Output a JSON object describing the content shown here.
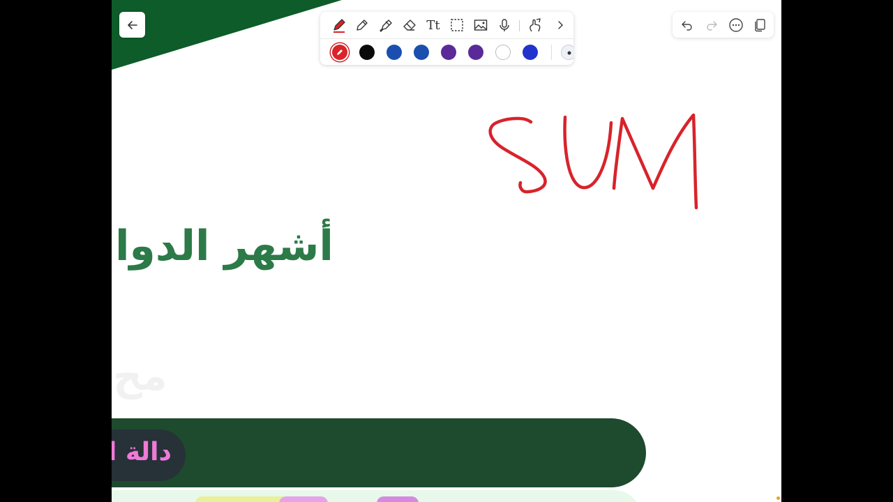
{
  "colors": {
    "brand_green": "#0d5c2a",
    "heading_green": "#2c7a48",
    "banner_green": "#1e4a2d",
    "pill_bg": "#263238",
    "pill_text": "#f07ad8",
    "ink_red": "#d8232a"
  },
  "toolbar": {
    "tools": [
      {
        "name": "pen",
        "icon": "pen-icon",
        "active": true
      },
      {
        "name": "pencil",
        "icon": "pencil-icon"
      },
      {
        "name": "highlighter",
        "icon": "highlighter-icon"
      },
      {
        "name": "eraser",
        "icon": "eraser-icon"
      },
      {
        "name": "text",
        "icon": "text-tool-icon",
        "label": "Tt"
      },
      {
        "name": "lasso-select",
        "icon": "select-icon"
      },
      {
        "name": "image",
        "icon": "image-icon"
      },
      {
        "name": "audio",
        "icon": "microphone-icon"
      },
      {
        "name": "touch-writing",
        "icon": "hand-pen-icon"
      },
      {
        "name": "more",
        "icon": "chevron-right-icon"
      }
    ],
    "swatches": [
      {
        "color": "#d8232a",
        "selected": true
      },
      {
        "color": "#0a0a0a"
      },
      {
        "color": "#1a4fb0"
      },
      {
        "color": "#1a4fb0"
      },
      {
        "color": "#5b2a99"
      },
      {
        "color": "#5b2a99"
      },
      {
        "color": "#ffffff"
      },
      {
        "color": "#2233cc"
      }
    ]
  },
  "header_actions": {
    "back": "arrow-left-icon",
    "undo": "undo-icon",
    "redo": "redo-icon",
    "more": "more-options-icon",
    "pages": "pages-icon"
  },
  "slide": {
    "heading": "أشهر الدوال",
    "watermark": "مح",
    "banner_pill_text": "دالة ا",
    "handwriting": "SUM"
  }
}
